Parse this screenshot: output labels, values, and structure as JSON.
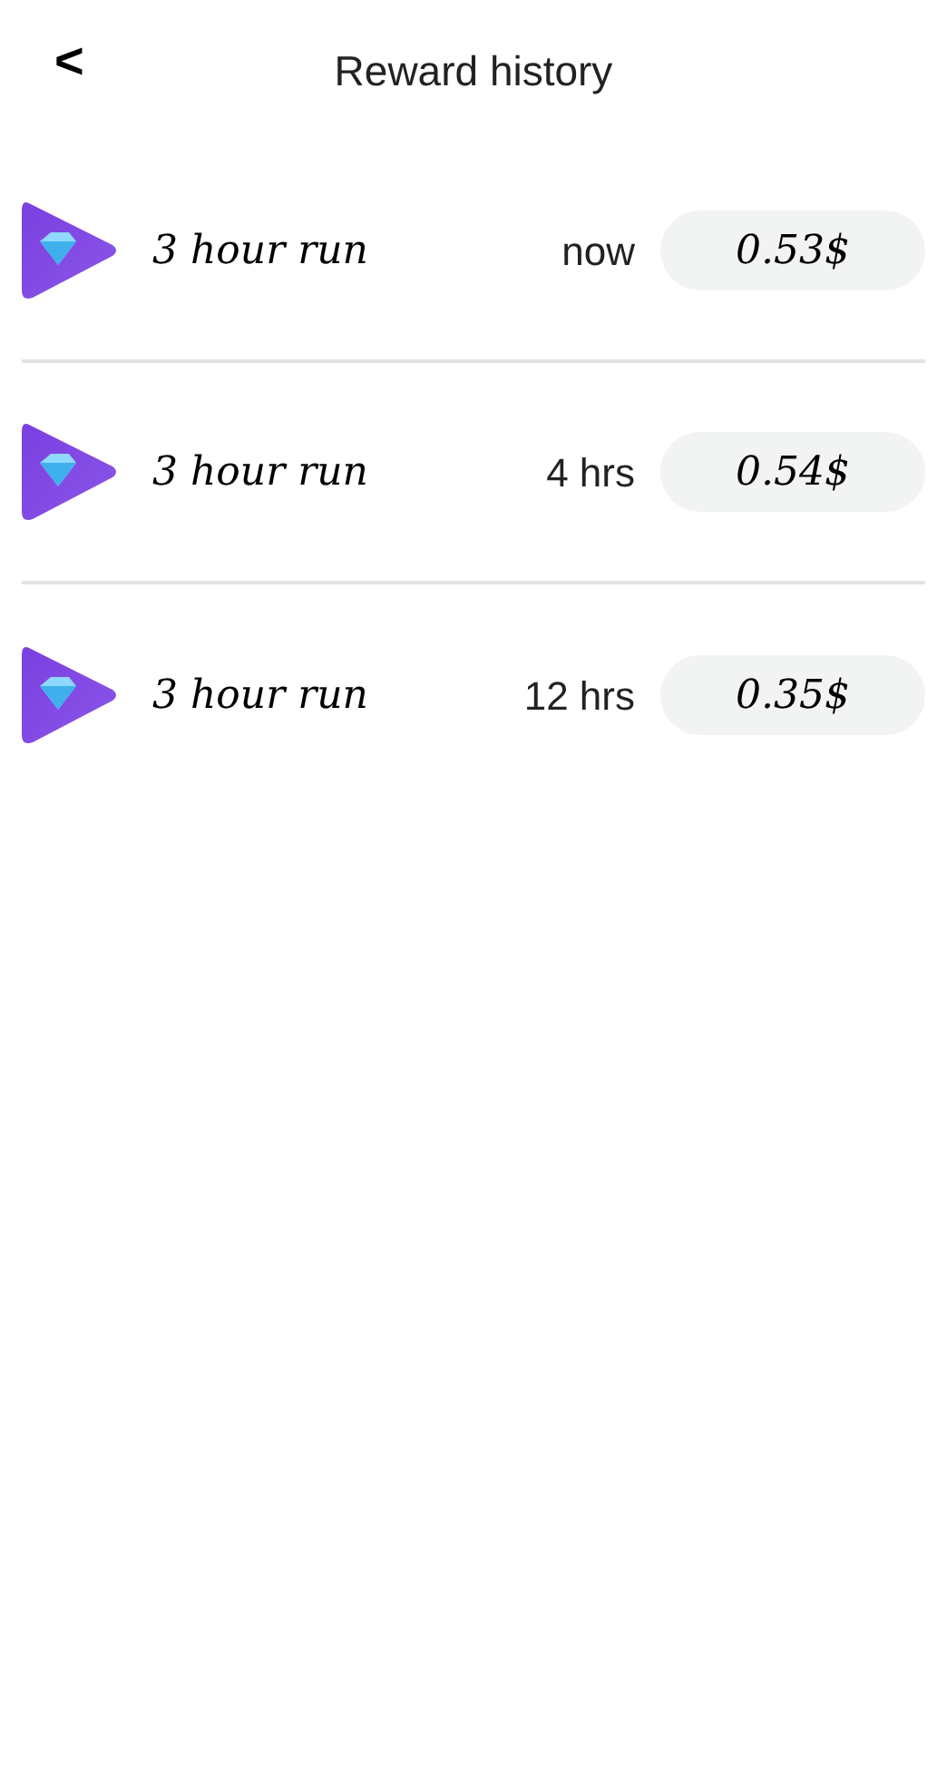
{
  "header": {
    "back": "<",
    "title": "Reward history"
  },
  "rewards": [
    {
      "title": "3 hour run",
      "time": "now",
      "amount": "0.53$"
    },
    {
      "title": "3 hour run",
      "time": "4 hrs",
      "amount": "0.54$"
    },
    {
      "title": "3 hour run",
      "time": "12 hrs",
      "amount": "0.35$"
    }
  ]
}
